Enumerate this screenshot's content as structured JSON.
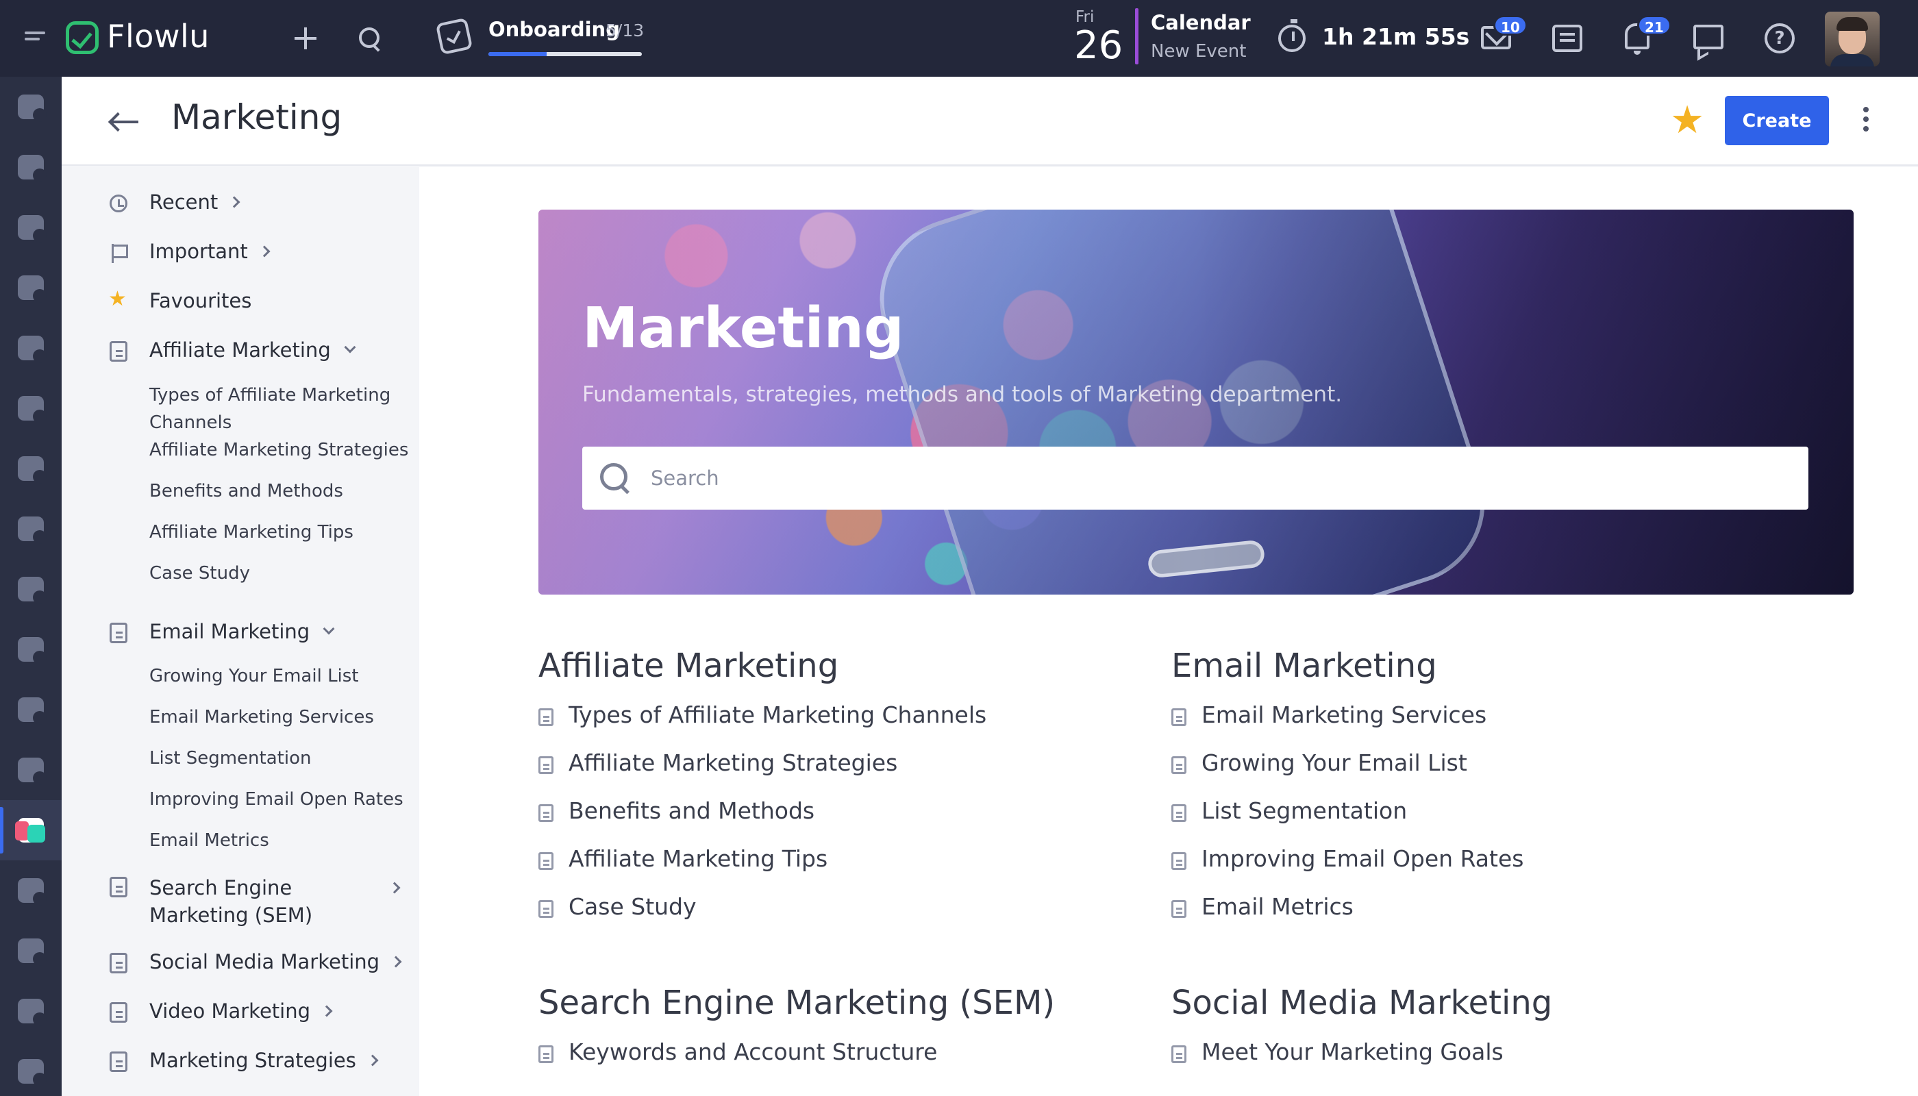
{
  "topbar": {
    "app_name": "Flowlu",
    "onboarding": {
      "label": "Onboarding",
      "count": "5/13",
      "progress": 0.38
    },
    "date": {
      "weekday": "Fri",
      "day": "26"
    },
    "calendar": {
      "title": "Calendar",
      "subtitle": "New Event"
    },
    "timer": "1h 21m 55s",
    "mail_badge": "10",
    "notifications_badge": "21",
    "icons": [
      "menu-icon",
      "plus-icon",
      "search-icon",
      "onboarding-icon",
      "timer-icon",
      "mail-icon",
      "notes-icon",
      "bell-icon",
      "chat-icon",
      "help-icon"
    ]
  },
  "page": {
    "title": "Marketing",
    "create_label": "Create",
    "star_glyph": "★"
  },
  "sidebar": {
    "recent": "Recent",
    "important": "Important",
    "favourites": "Favourites",
    "affiliate": {
      "label": "Affiliate Marketing",
      "children": [
        "Types of Affiliate Marketing Channels",
        "Affiliate Marketing Strategies",
        "Benefits and Methods",
        "Affiliate Marketing Tips",
        "Case Study"
      ]
    },
    "email": {
      "label": "Email Marketing",
      "children": [
        "Growing Your Email List",
        "Email Marketing Services",
        "List Segmentation",
        "Improving Email Open Rates",
        "Email Metrics"
      ]
    },
    "sem": "Search Engine Marketing (SEM)",
    "social": "Social Media Marketing",
    "video": "Video Marketing",
    "strategies": "Marketing Strategies"
  },
  "hero": {
    "title": "Marketing",
    "subtitle": "Fundamentals, strategies, methods and tools of Marketing department.",
    "search_placeholder": "Search"
  },
  "sections": {
    "affiliate": {
      "title": "Affiliate Marketing",
      "items": [
        "Types of Affiliate Marketing Channels",
        "Affiliate Marketing Strategies",
        "Benefits and Methods",
        "Affiliate Marketing Tips",
        "Case Study"
      ]
    },
    "email": {
      "title": "Email Marketing",
      "items": [
        "Email Marketing Services",
        "Growing Your Email List",
        "List Segmentation",
        "Improving Email Open Rates",
        "Email Metrics"
      ]
    },
    "sem": {
      "title": "Search Engine Marketing (SEM)",
      "items": [
        "Keywords and Account Structure"
      ]
    },
    "social": {
      "title": "Social Media Marketing",
      "items": [
        "Meet Your Marketing Goals"
      ]
    }
  },
  "colors": {
    "topbar": "#23273a",
    "rail": "#2b3044",
    "accent": "#2f62e9",
    "star": "#f4b223",
    "logo": "#2fbf71"
  }
}
